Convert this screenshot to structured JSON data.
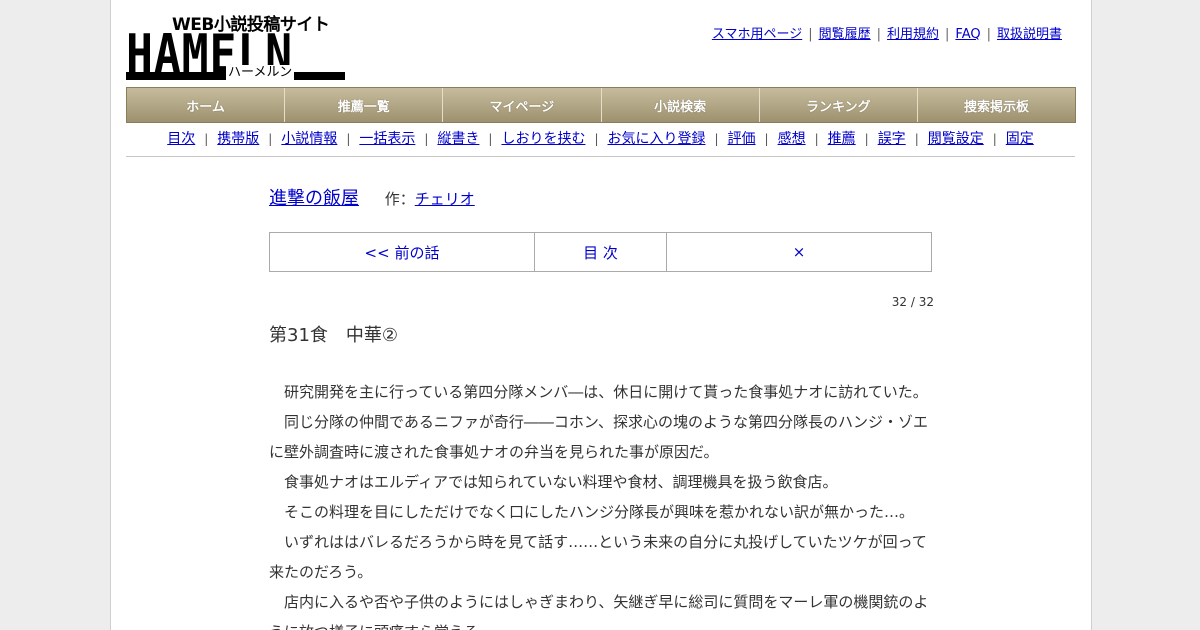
{
  "logo": {
    "tagline": "WEB小説投稿サイト",
    "wordmark": "HAMELN",
    "kana": "ハーメルン"
  },
  "toplinks": [
    "スマホ用ページ",
    "閲覧履歴",
    "利用規約",
    "FAQ",
    "取扱説明書"
  ],
  "mainnav": [
    "ホーム",
    "推薦一覧",
    "マイページ",
    "小説検索",
    "ランキング",
    "捜索掲示板"
  ],
  "subnav": [
    "目次",
    "携帯版",
    "小説情報",
    "一括表示",
    "縦書き",
    "しおりを挟む",
    "お気に入り登録",
    "評価",
    "感想",
    "推薦",
    "誤字",
    "閲覧設定",
    "固定"
  ],
  "novel": {
    "title": "進撃の飯屋",
    "author_label": "作：",
    "author": "チェリオ"
  },
  "chapter_nav": {
    "prev": "<< 前の話",
    "toc": "目 次",
    "next": "×"
  },
  "counter": "32 / 32",
  "chapter_title": "第31食　中華②",
  "paragraphs": [
    "研究開発を主に行っている第四分隊メンバ―は、休日に開けて貰った食事処ナオに訪れていた。",
    "同じ分隊の仲間であるニファが奇行――コホン、探求心の塊のような第四分隊長のハンジ・ゾエに壁外調査時に渡された食事処ナオの弁当を見られた事が原因だ。",
    "食事処ナオはエルディアでは知られていない料理や食材、調理機具を扱う飲食店。",
    "そこの料理を目にしただけでなく口にしたハンジ分隊長が興味を惹かれない訳が無かった…。",
    "いずれははバレるだろうから時を見て話す……という未来の自分に丸投げしていたツケが回って来たのだろう。",
    "店内に入るや否や子供のようにはしゃぎまわり、矢継ぎ早に総司に質問をマーレ軍の機関銃のように放つ様子に頭痛すら覚える。"
  ]
}
